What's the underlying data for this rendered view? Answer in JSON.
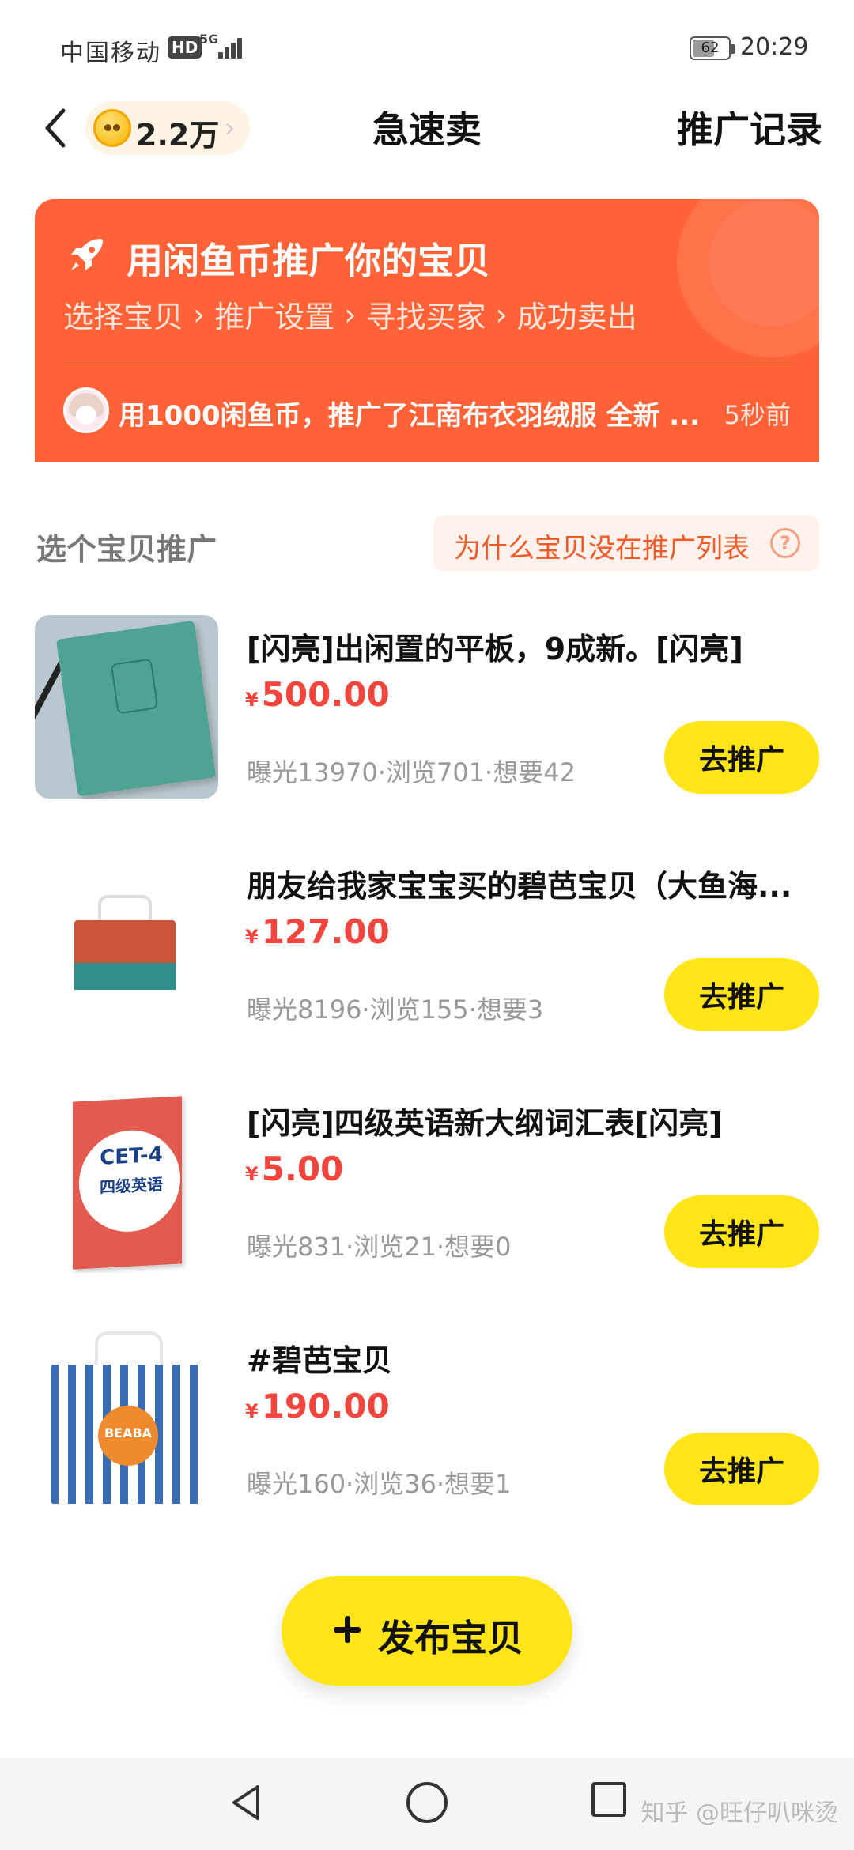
{
  "status_bar": {
    "carrier": "中国移动",
    "hd": "HD",
    "network": "5G",
    "battery": "62",
    "battery_level": 0.62,
    "time": "20:29"
  },
  "header": {
    "coin_amount": "2.2万",
    "title": "急速卖",
    "record_link": "推广记录"
  },
  "banner": {
    "title": "用闲鱼币推广你的宝贝",
    "steps": [
      "选择宝贝",
      "推广设置",
      "寻找买家",
      "成功卖出"
    ],
    "feed_text": "用1000闲鱼币，推广了江南布衣羽绒服 全新 ...",
    "feed_time": "5秒前"
  },
  "section": {
    "title": "选个宝贝推广",
    "why_text": "为什么宝贝没在推广列表",
    "help_symbol": "?"
  },
  "items": [
    {
      "title": "[闪亮]出闲置的平板，9成新。[闪亮]",
      "currency": "¥",
      "price": "500.00",
      "stats": "曝光13970·浏览701·想要42",
      "button": "去推广"
    },
    {
      "title": "朋友给我家宝宝买的碧芭宝贝（大鱼海...",
      "currency": "¥",
      "price": "127.00",
      "stats": "曝光8196·浏览155·想要3",
      "button": "去推广"
    },
    {
      "title": "[闪亮]四级英语新大纲词汇表[闪亮]",
      "currency": "¥",
      "price": "5.00",
      "stats": "曝光831·浏览21·想要0",
      "button": "去推广"
    },
    {
      "title": "#碧芭宝贝",
      "currency": "¥",
      "price": "190.00",
      "stats": "曝光160·浏览36·想要1",
      "button": "去推广"
    }
  ],
  "thumb_text": {
    "cet": "CET-4",
    "cet_cn": "四级英语",
    "beaba": "BEABA"
  },
  "publish": {
    "label": "发布宝贝"
  },
  "navbar": {
    "watermark": "知乎 @旺仔叭咪烫"
  },
  "colors": {
    "banner": "#ff6236",
    "accent_yellow": "#ffe418",
    "price_red": "#f2453d"
  }
}
